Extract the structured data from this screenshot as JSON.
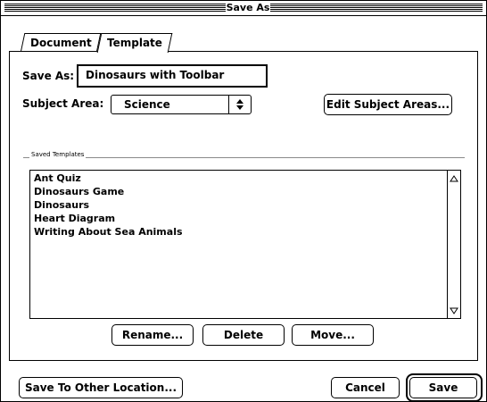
{
  "window": {
    "title": "Save As"
  },
  "tabs": [
    {
      "label": "Document"
    },
    {
      "label": "Template"
    }
  ],
  "form": {
    "save_as_label": "Save As:",
    "save_as_value": "Dinosaurs with Toolbar",
    "subject_area_label": "Subject Area:",
    "subject_area_value": "Science",
    "edit_subject_areas_label": "Edit Subject Areas..."
  },
  "saved_templates": {
    "group_label": "Saved Templates",
    "items": [
      {
        "label": "Ant Quiz"
      },
      {
        "label": "Dinosaurs Game"
      },
      {
        "label": "Dinosaurs"
      },
      {
        "label": "Heart Diagram"
      },
      {
        "label": "Writing About Sea Animals"
      }
    ],
    "rename_label": "Rename...",
    "delete_label": "Delete",
    "move_label": "Move..."
  },
  "footer": {
    "save_other_label": "Save To Other Location...",
    "cancel_label": "Cancel",
    "save_label": "Save"
  },
  "icons": {
    "popup_arrows": "up-down-arrows-icon",
    "scroll_up": "scroll-up-icon",
    "scroll_down": "scroll-down-icon"
  }
}
